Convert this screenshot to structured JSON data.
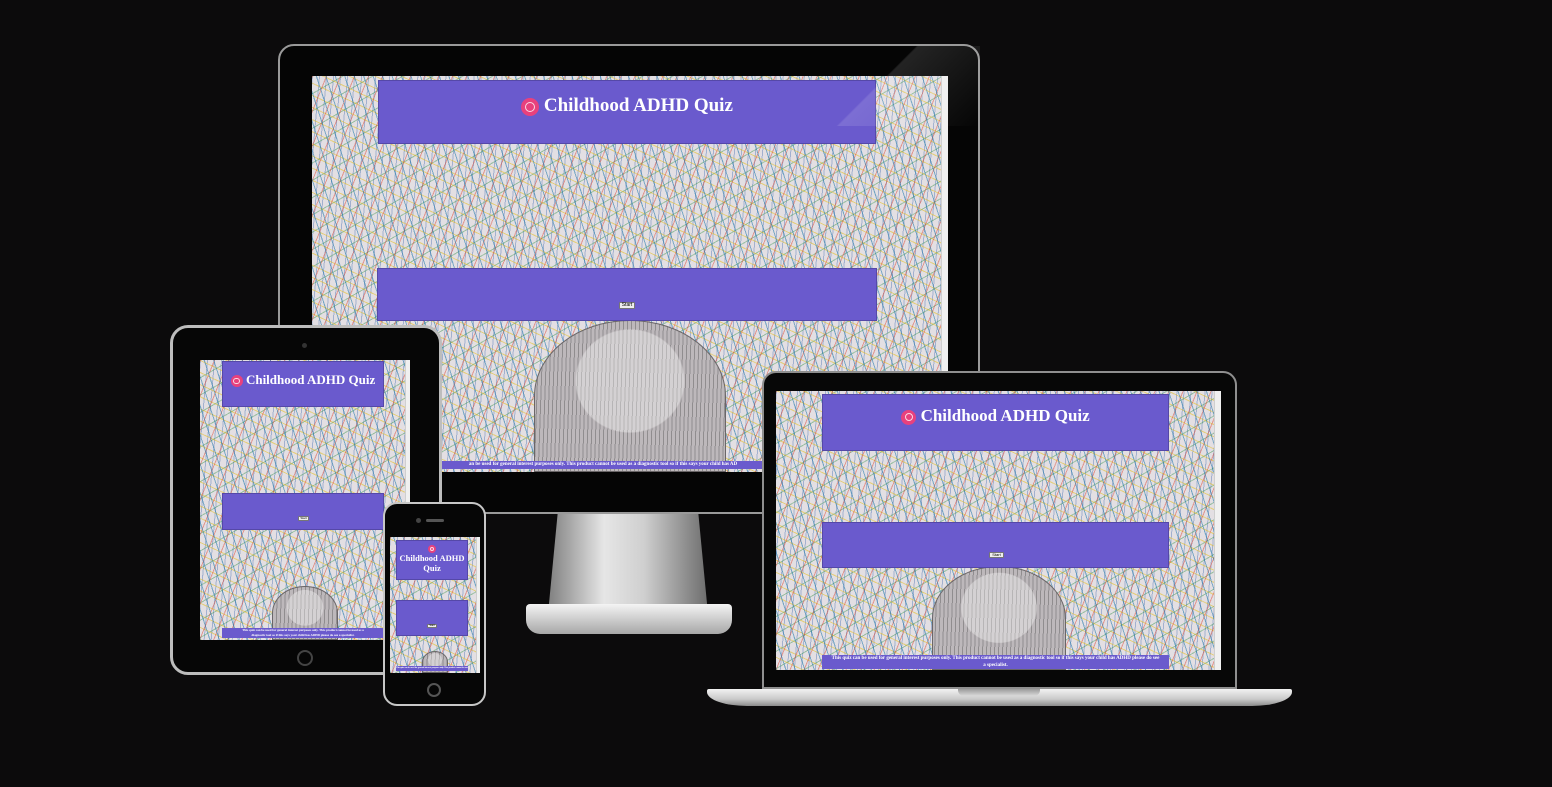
{
  "quiz": {
    "title": "Childhood ADHD Quiz",
    "title_short_line1": "Childhood ADHD",
    "title_short_line2": "Quiz",
    "logo_icon": "adhd-logo-icon",
    "start_label": "Start",
    "disclaimer": "This quiz can be used for general interest purposes only. This product cannot be used as a diagnostic tool so if this says your child has ADHD please do see a specialist.",
    "disclaimer_desktop": "an be used for general interest purposes only. This product cannot be used as a diagnostic tool so if this says your child has AD",
    "disclaimer_laptop_line1": "This quiz can be used for general interest purposes only. This product cannot be used as a diagnostic tool so if this says your child has ADHD please do see",
    "disclaimer_laptop_line2": "a specialist.",
    "disclaimer_tablet_line1": "This quiz can be used for general interest purposes only. This product cannot be used as a",
    "disclaimer_tablet_line2": "diagnostic tool so if this says your child has ADHD please do see a specialist."
  },
  "colors": {
    "background": "#0c0b0c",
    "panel": "#6a5acd",
    "logo": "#e8417d",
    "text": "#ffffff"
  },
  "devices": [
    "desktop",
    "tablet",
    "phone",
    "laptop"
  ]
}
